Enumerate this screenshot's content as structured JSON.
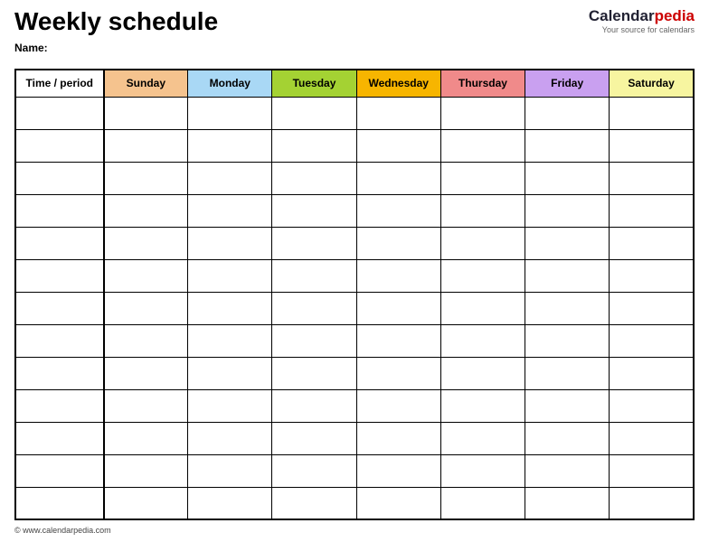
{
  "header": {
    "title": "Weekly schedule",
    "name_label": "Name:",
    "brand_cal": "Calendar",
    "brand_pedia": "pedia",
    "brand_tag": "Your source for calendars"
  },
  "table": {
    "time_period": "Time / period",
    "days": {
      "sun": "Sunday",
      "mon": "Monday",
      "tue": "Tuesday",
      "wed": "Wednesday",
      "thu": "Thursday",
      "fri": "Friday",
      "sat": "Saturday"
    },
    "colors": {
      "sun": "#f5c38e",
      "mon": "#a9d8f5",
      "tue": "#a4d233",
      "wed": "#f7b500",
      "thu": "#f08a8a",
      "fri": "#c9a0f0",
      "sat": "#f7f5a0"
    },
    "rows": 13
  },
  "footer": {
    "copyright": "© www.calendarpedia.com"
  }
}
